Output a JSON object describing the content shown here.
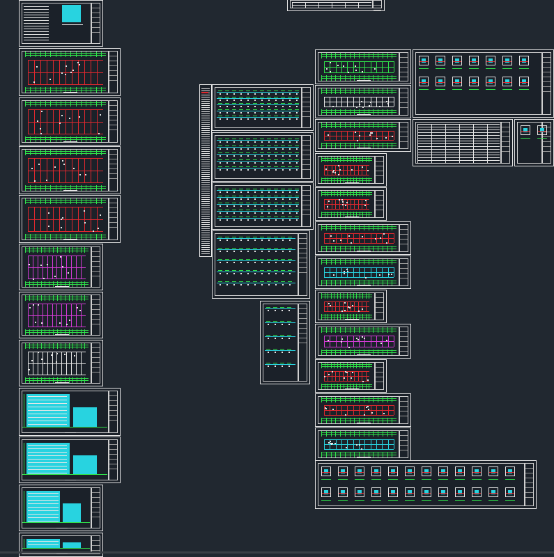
{
  "viewport": {
    "background": "#212830"
  },
  "colors": {
    "frame": "#e6e6e6",
    "green": "#2fe04a",
    "cyan": "#28d3e0",
    "red": "#e0282e",
    "magenta": "#d43bd6"
  },
  "groups": {
    "left_column": {
      "sheet_count": 13
    },
    "center_column": {
      "sheet_count": 6
    },
    "right_column": {
      "sheet_count": 15
    }
  }
}
